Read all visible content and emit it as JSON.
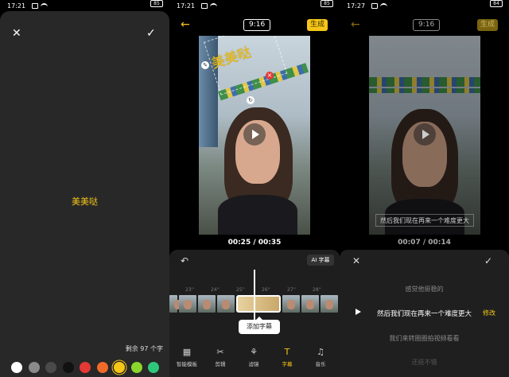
{
  "screens": [
    {
      "status": {
        "time": "17:21",
        "battery": "85"
      },
      "text_value": "美美哒",
      "remaining": "剩余 97 个字",
      "colors": [
        {
          "hex": "#ffffff",
          "selected": false
        },
        {
          "hex": "#8a8a8a",
          "selected": false
        },
        {
          "hex": "#4a4a4a",
          "selected": false
        },
        {
          "hex": "#111111",
          "selected": false
        },
        {
          "hex": "#e53935",
          "selected": false
        },
        {
          "hex": "#f06a2a",
          "selected": false
        },
        {
          "hex": "#f5c518",
          "selected": true
        },
        {
          "hex": "#8bd62b",
          "selected": false
        },
        {
          "hex": "#2ec87a",
          "selected": false
        }
      ]
    },
    {
      "status": {
        "time": "17:21",
        "battery": "85"
      },
      "ratio": "9:16",
      "generate": "生成",
      "sticker_text": "美美哒",
      "timecode": "00:25 / 00:35",
      "ai_subtitle": "AI 字幕",
      "ticks": [
        "23''",
        "24''",
        "25''",
        "26''",
        "27''",
        "28''"
      ],
      "add_subtitle": "添加字幕",
      "tabs": [
        {
          "label": "智能模板",
          "icon": "grid-icon",
          "glyph": "▦",
          "active": false
        },
        {
          "label": "剪辑",
          "icon": "cut-icon",
          "glyph": "✂",
          "active": false
        },
        {
          "label": "滤镜",
          "icon": "filter-icon",
          "glyph": "⚘",
          "active": false
        },
        {
          "label": "字幕",
          "icon": "text-icon",
          "glyph": "T",
          "active": true
        },
        {
          "label": "音乐",
          "icon": "music-icon",
          "glyph": "♫",
          "active": false
        }
      ]
    },
    {
      "status": {
        "time": "17:27",
        "battery": "84"
      },
      "ratio": "9:16",
      "generate": "生成",
      "overlay_subtitle": "然后我们现在再来一个难度更大",
      "timecode": "00:07 / 00:14",
      "lines": [
        "感觉他挺稳的",
        "然后我们现在再来一个难度更大",
        "我们来转圈圈拍视频看看",
        "还挺不错"
      ],
      "modify": "修改"
    }
  ]
}
